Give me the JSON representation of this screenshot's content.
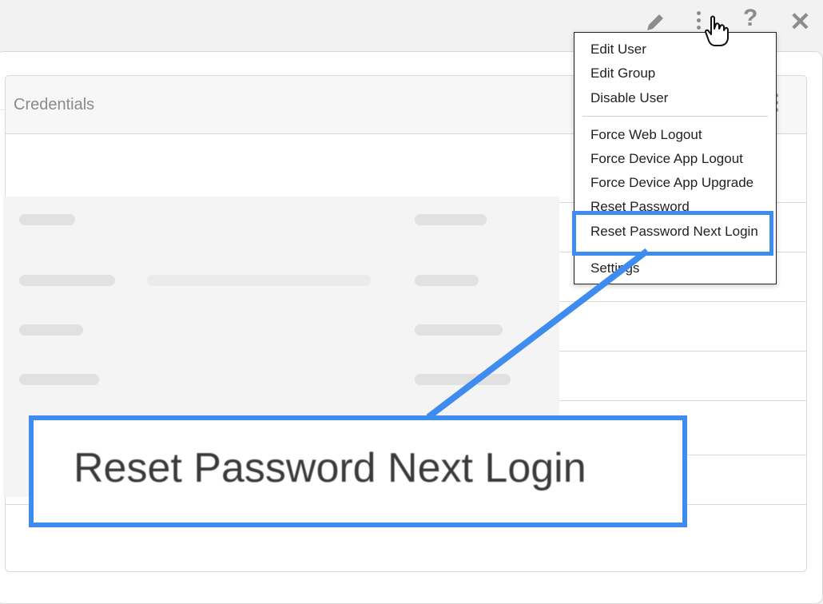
{
  "toolbar": {
    "icons": [
      "pencil-icon",
      "kebab-icon",
      "help-icon",
      "close-icon"
    ],
    "help_glyph": "?",
    "close_glyph": "✕"
  },
  "card": {
    "title": "Credentials"
  },
  "menu": {
    "items": [
      {
        "label": "Edit User"
      },
      {
        "label": "Edit Group"
      },
      {
        "label": "Disable User"
      },
      {
        "label": "Force Web Logout"
      },
      {
        "label": "Force Device App Logout"
      },
      {
        "label": "Force Device App Upgrade"
      },
      {
        "label": "Reset Password"
      },
      {
        "label": "Reset Password Next Login"
      },
      {
        "label": "Settings"
      }
    ]
  },
  "callout": {
    "text": "Reset Password Next Login"
  },
  "colors": {
    "highlight": "#3f8cf0"
  }
}
